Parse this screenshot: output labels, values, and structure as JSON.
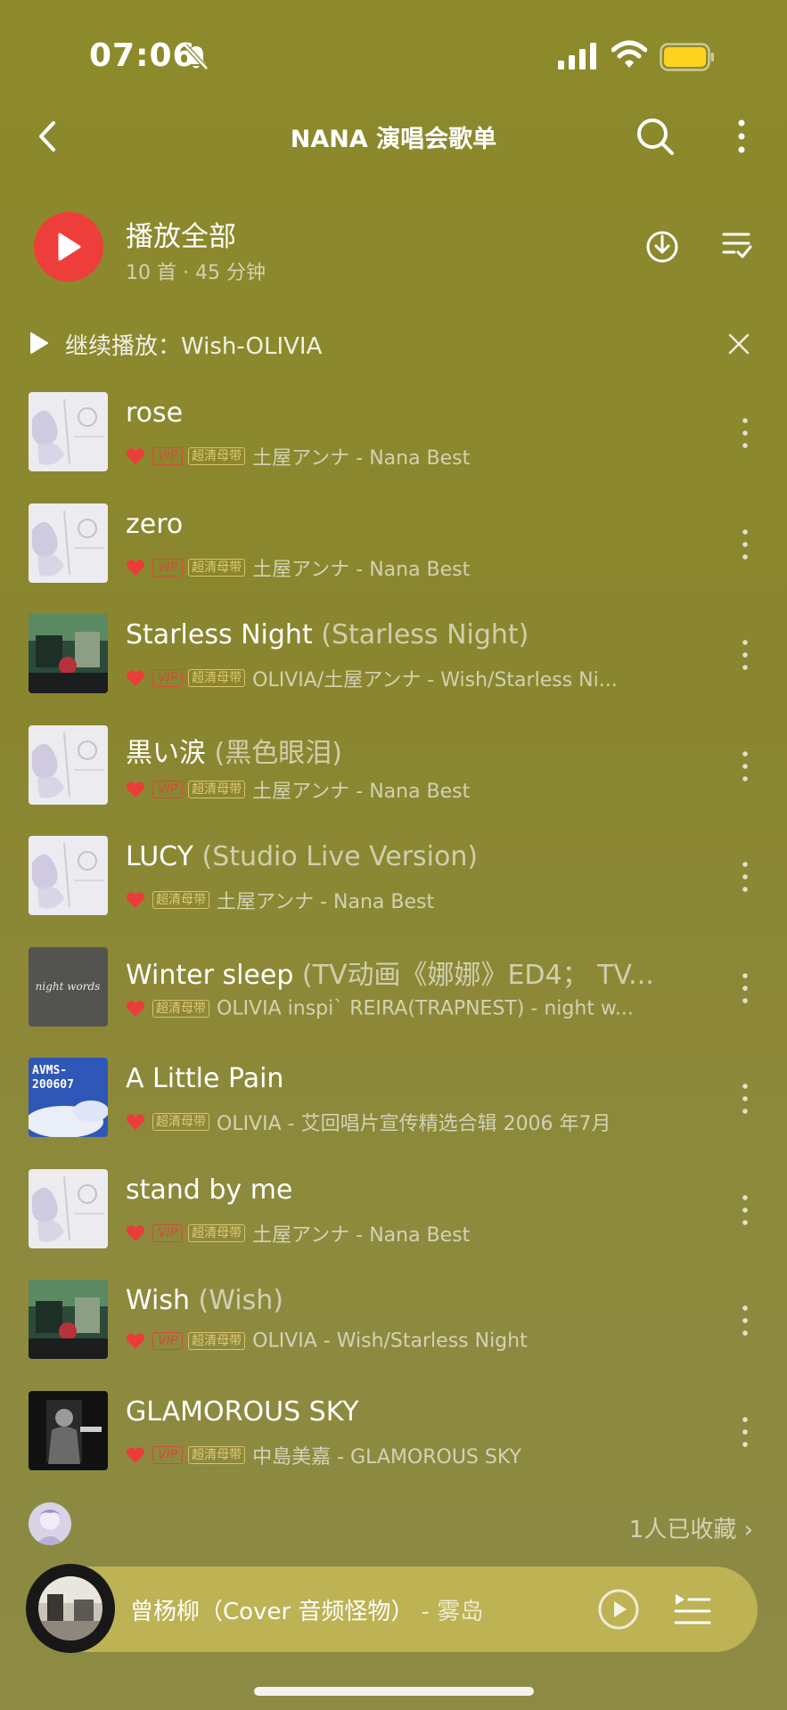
{
  "status_bar": {
    "time": "07:06",
    "icons": [
      "bell-off-icon",
      "signal-icon",
      "wifi-icon",
      "battery-icon"
    ],
    "battery_color": "#ffd21f"
  },
  "header": {
    "title": "NANA 演唱会歌单",
    "back_icon": "chevron-left-icon",
    "search_icon": "search-icon",
    "more_icon": "more-vertical-icon"
  },
  "play_all": {
    "label": "播放全部",
    "summary": "10 首 · 45 分钟",
    "accent_color": "#ee3e3c",
    "download_icon": "download-icon",
    "multiselect_icon": "multiselect-icon"
  },
  "continue": {
    "label": "继续播放：Wish-OLIVIA",
    "close_icon": "close-icon"
  },
  "badges": {
    "vip": "VIP",
    "hq": "超清母带"
  },
  "songs": [
    {
      "title": "rose",
      "alias": "",
      "meta": "土屋アンナ - Nana Best",
      "vip": true,
      "cover": "nana-best"
    },
    {
      "title": "zero",
      "alias": "",
      "meta": "土屋アンナ - Nana Best",
      "vip": true,
      "cover": "nana-best"
    },
    {
      "title": "Starless Night",
      "alias": "(Starless Night)",
      "meta": "OLIVIA/土屋アンナ - Wish/Starless Ni...",
      "vip": true,
      "cover": "wish"
    },
    {
      "title": "黒い涙",
      "alias": "(黑色眼泪)",
      "meta": "土屋アンナ - Nana Best",
      "vip": true,
      "cover": "nana-best"
    },
    {
      "title": "LUCY",
      "alias": "(Studio Live Version)",
      "meta": "土屋アンナ - Nana Best",
      "vip": false,
      "cover": "nana-best"
    },
    {
      "title": "Winter sleep",
      "alias": "(TV动画《娜娜》ED4； TV...",
      "meta": "OLIVIA inspi` REIRA(TRAPNEST) - night w...",
      "vip": false,
      "cover": "night-words"
    },
    {
      "title": "A Little Pain",
      "alias": "",
      "meta": "OLIVIA - 艾回唱片宣传精选合辑 2006 年7月",
      "vip": false,
      "cover": "avms"
    },
    {
      "title": "stand by me",
      "alias": "",
      "meta": "土屋アンナ - Nana Best",
      "vip": true,
      "cover": "nana-best"
    },
    {
      "title": "Wish",
      "alias": "(Wish)",
      "meta": "OLIVIA - Wish/Starless Night",
      "vip": true,
      "cover": "wish"
    },
    {
      "title": "GLAMOROUS SKY",
      "alias": "",
      "meta": "中島美嘉 - GLAMOROUS SKY",
      "vip": true,
      "cover": "glamorous"
    }
  ],
  "collect": {
    "text": "1人已收藏 ›"
  },
  "cover_text": {
    "night_words": "night words",
    "avms": "AVMS-200607"
  },
  "mini_player": {
    "title": "曾杨柳（Cover 音频怪物）",
    "artist": " - 雾岛",
    "play_icon": "play-circle-icon",
    "queue_icon": "queue-icon"
  }
}
